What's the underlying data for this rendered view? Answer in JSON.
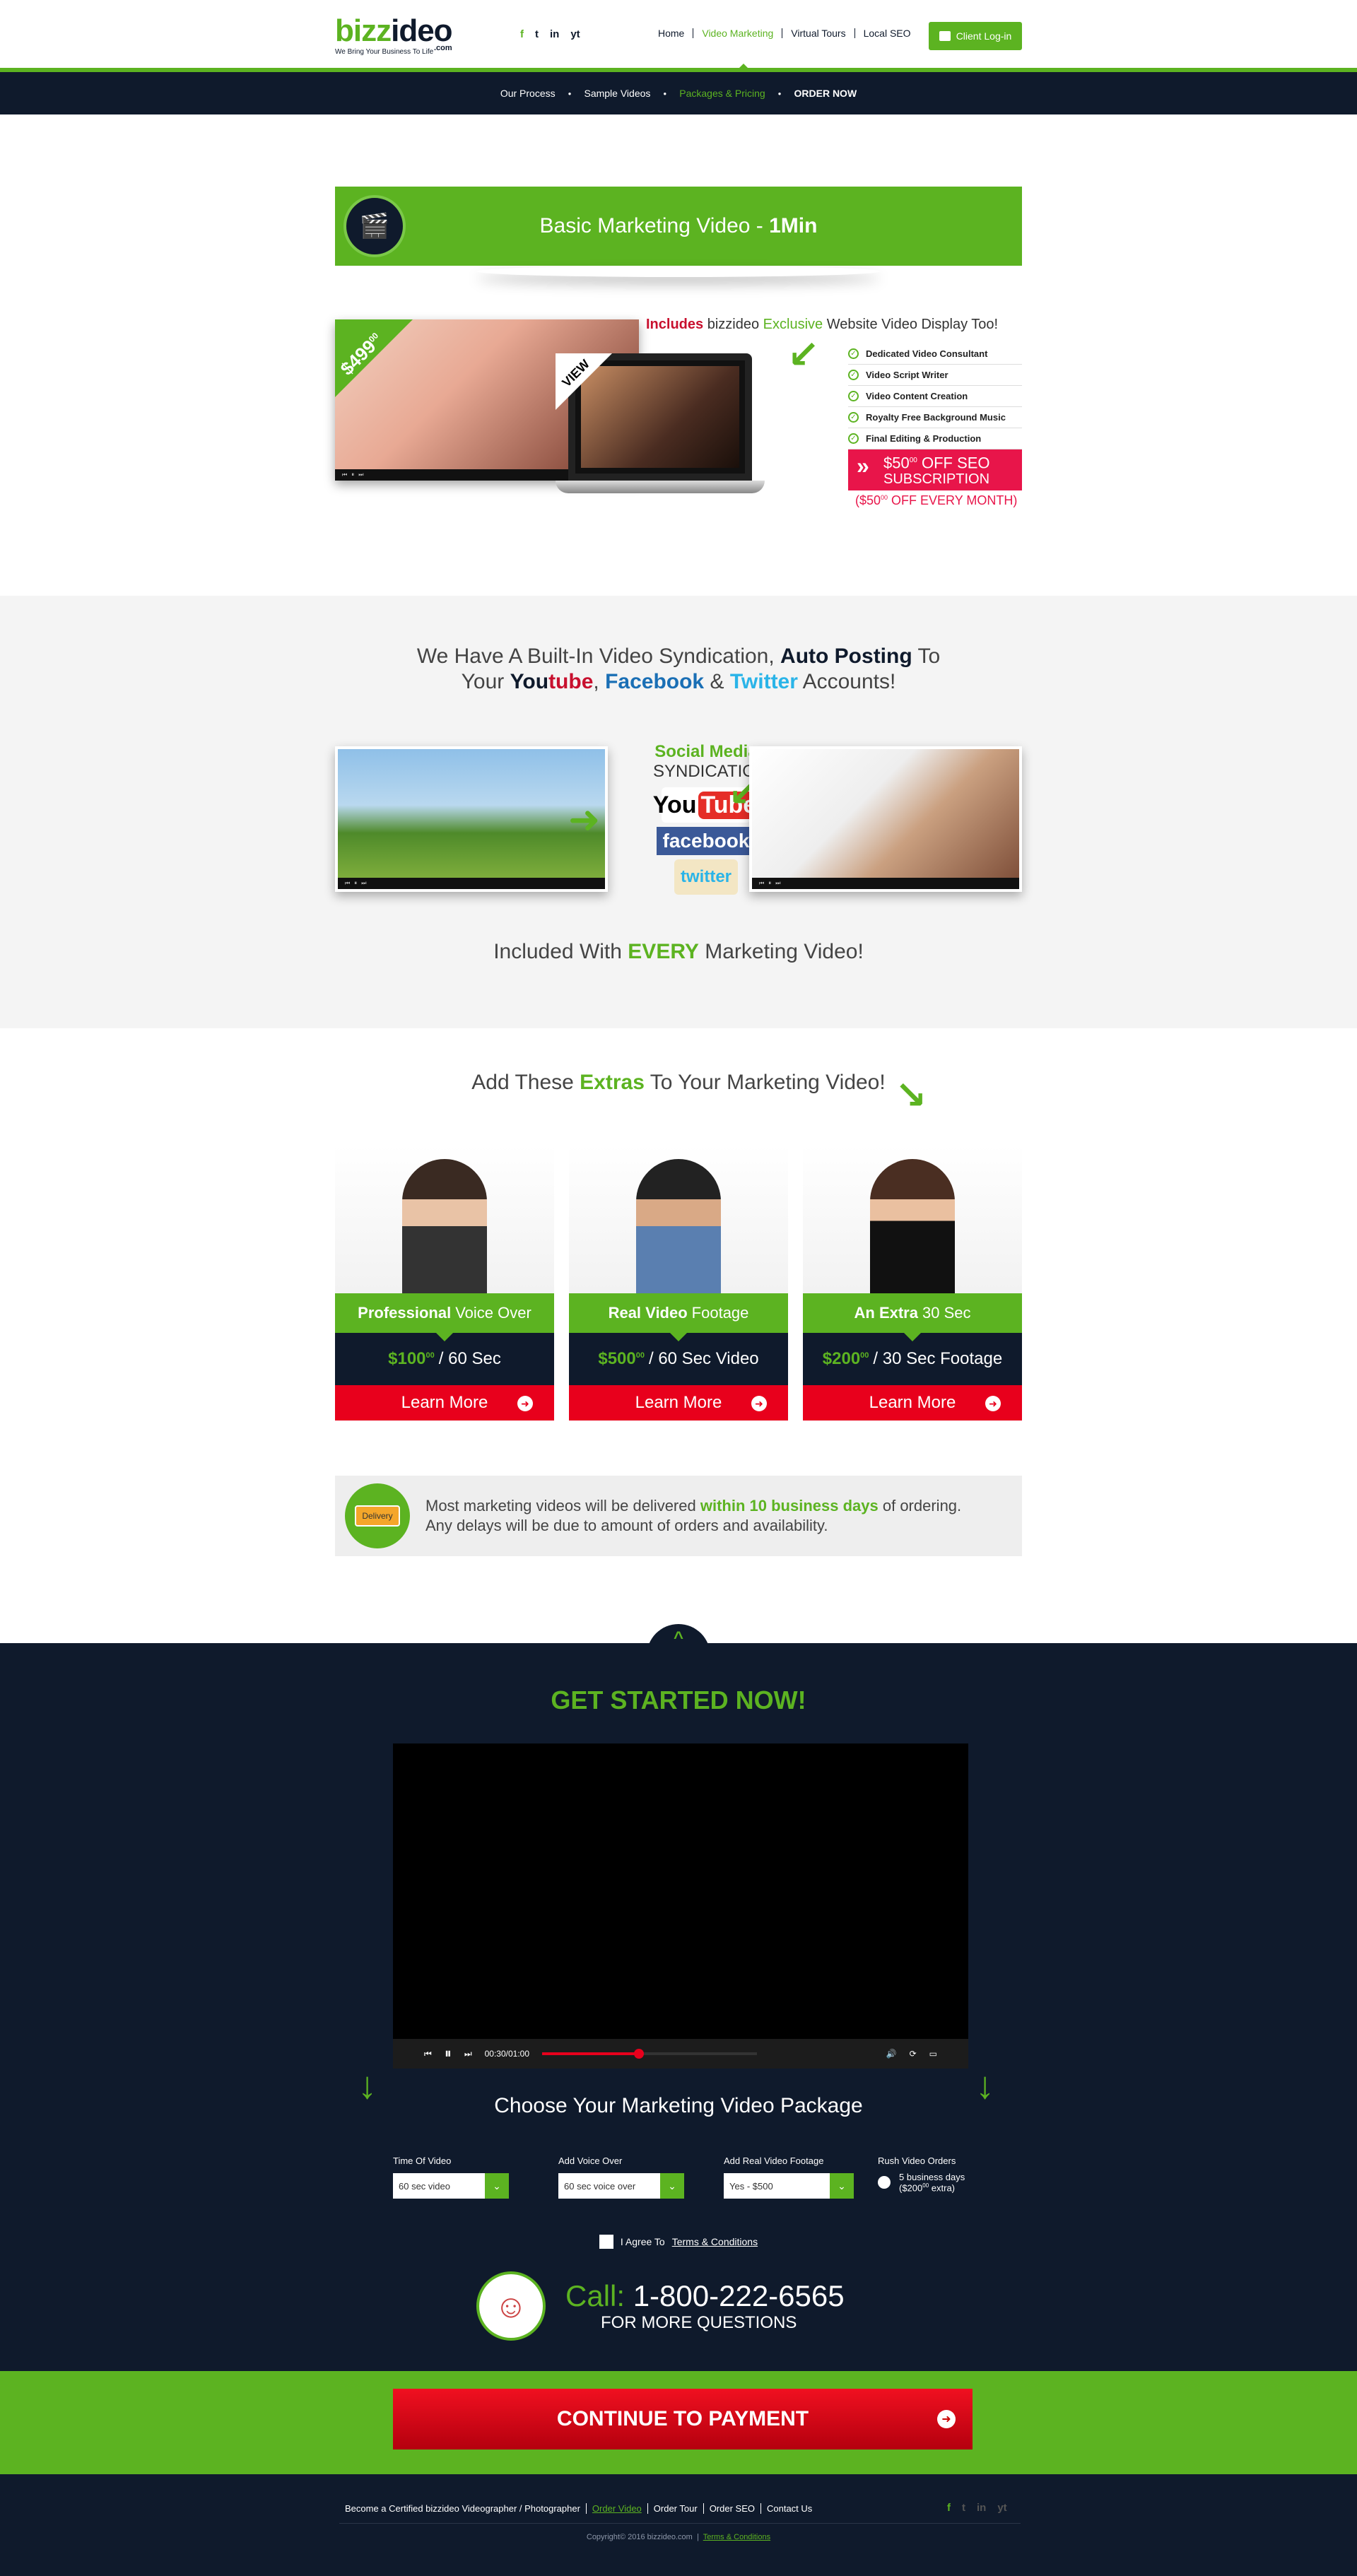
{
  "header": {
    "logo_a": "bizz",
    "logo_b": "ideo",
    "logo_com": ".com",
    "tagline": "We Bring Your Business To Life",
    "social": [
      "f",
      "t",
      "in",
      "yt"
    ],
    "nav": [
      "Home",
      "Video Marketing",
      "Virtual Tours",
      "Local SEO"
    ],
    "login": "Client Log-in"
  },
  "subnav": [
    "Our Process",
    "Sample Videos",
    "Packages & Pricing",
    "ORDER NOW"
  ],
  "banner": {
    "title": "Basic Marketing Video - ",
    "bold": "1Min"
  },
  "promo": {
    "price": "$499",
    "price_sup": "00",
    "view": "VIEW",
    "includes": "Includes",
    "brand": "bizzideo",
    "exclusive": "Exclusive",
    "rest": "Website Video Display Too!",
    "features": [
      "Dedicated Video Consultant",
      "Video Script Writer",
      "Video Content Creation",
      "Royalty Free Background Music",
      "Final Editing & Production"
    ],
    "seo_main": "$50",
    "seo_sup": "00",
    "seo_off": "OFF SEO",
    "seo_sub": "SUBSCRIPTION",
    "seo_monthly": "($50",
    "seo_monthly2": " OFF EVERY MONTH)"
  },
  "syndication": {
    "l1a": "We Have A Built-In Video Syndication,",
    "l1b": "Auto Posting",
    "l1c": "To",
    "l2a": "Your",
    "yt1": "You",
    "yt2": "tube",
    "fb": "Facebook",
    "amp": "&",
    "tw": "Twitter",
    "l2e": "Accounts!",
    "sm1": "Social Media",
    "sm2": "SYNDICATION",
    "ytlogo": "You",
    "ytlogo2": "Tube",
    "fblogo": "facebook",
    "twlogo": "twitter",
    "incl_a": "Included With",
    "incl_b": "EVERY",
    "incl_c": "Marketing Video!"
  },
  "extras": {
    "title_a": "Add These",
    "title_b": "Extras",
    "title_c": "To Your Marketing Video!",
    "cards": [
      {
        "cap_b": "Professional",
        "cap": "Voice Over",
        "price": "$100",
        "sup": "00",
        "per": "/ 60 Sec",
        "btn": "Learn More"
      },
      {
        "cap_b": "Real Video",
        "cap": "Footage",
        "price": "$500",
        "sup": "00",
        "per": "/ 60 Sec Video",
        "btn": "Learn More"
      },
      {
        "cap_b": "An Extra",
        "cap": "30 Sec",
        "price": "$200",
        "sup": "00",
        "per": "/ 30 Sec Footage",
        "btn": "Learn More"
      }
    ]
  },
  "delivery": {
    "icon": "Delivery",
    "a": "Most marketing videos will be delivered",
    "b": "within 10 business days",
    "c": "of ordering.",
    "d": "Any delays will be due to amount of orders and availability."
  },
  "get_started": "GET STARTED NOW!",
  "player": {
    "time": "00:30/01:00",
    "progress": 0.45
  },
  "choose": "Choose Your Marketing Video Package",
  "form": {
    "time_label": "Time Of Video",
    "time_val": "60 sec video",
    "voice_label": "Add Voice Over",
    "voice_val": "60 sec voice over",
    "footage_label": "Add Real Video Footage",
    "footage_val": "Yes - $500",
    "rush_label": "Rush Video Orders",
    "rush_a": "5 business days",
    "rush_b": "($200",
    "rush_sup": "00",
    "rush_c": " extra)"
  },
  "agree": {
    "a": "I Agree To",
    "b": "Terms & Conditions"
  },
  "call": {
    "label": "Call:",
    "number": "1-800-222-6565",
    "more": "FOR MORE QUESTIONS"
  },
  "pay": "CONTINUE TO PAYMENT",
  "footer": {
    "links": [
      "Become a Certified bizzideo Videographer / Photographer",
      "Order Video",
      "Order Tour",
      "Order SEO",
      "Contact Us"
    ],
    "copyright": "Copyright© 2016 bizzideo.com",
    "terms": "Terms & Conditions"
  },
  "colors": {
    "green": "#5cb321",
    "navy": "#0f1a2c",
    "red": "#e8001c"
  }
}
